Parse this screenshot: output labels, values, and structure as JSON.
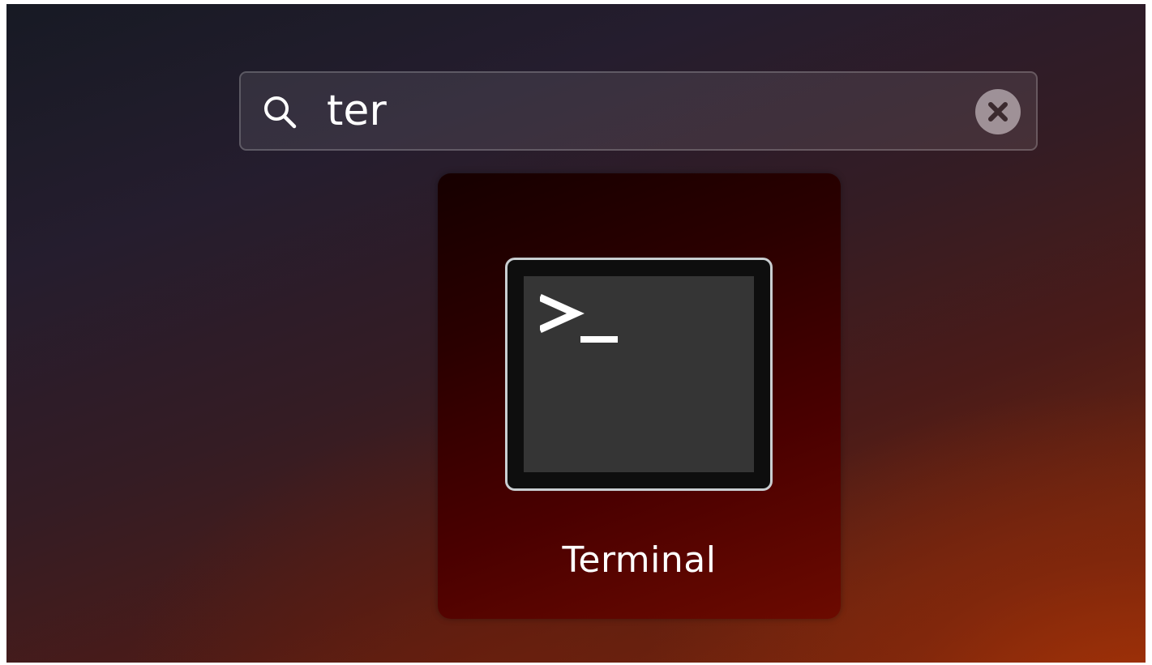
{
  "search": {
    "query": "ter",
    "icon": "search-icon",
    "clear_icon": "close-icon"
  },
  "results": [
    {
      "name": "Terminal",
      "icon": "terminal-icon"
    }
  ],
  "colors": {
    "accent_orange": "#a8350a",
    "tile_background": "#3a0000",
    "text": "#ffffff"
  }
}
